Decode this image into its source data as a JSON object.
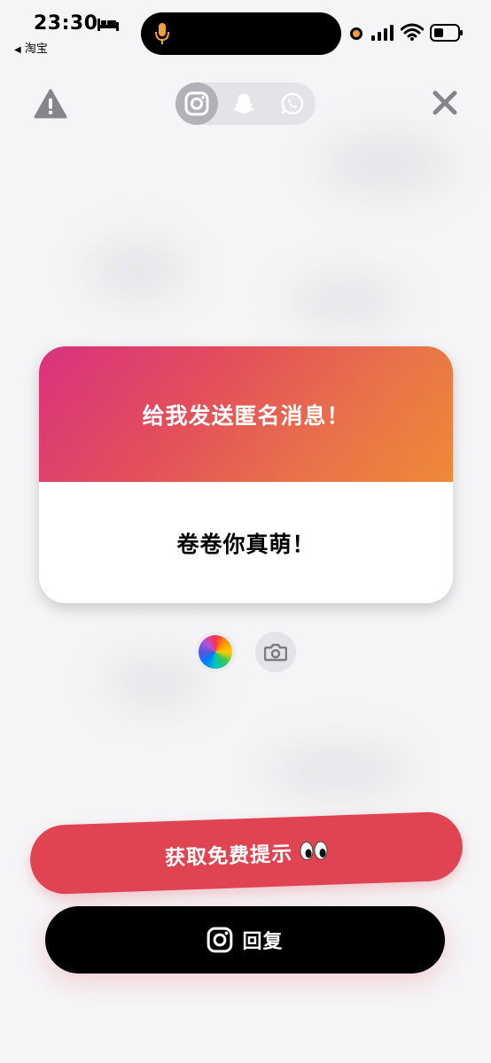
{
  "status_bar": {
    "time": "23:30",
    "back_app": "淘宝",
    "icons": [
      "bed-icon",
      "microphone-icon",
      "recording-dot",
      "cellular-signal-icon",
      "wifi-icon",
      "battery-icon"
    ]
  },
  "toolbar": {
    "warning_icon": "warning-triangle-icon",
    "close_icon": "close-icon",
    "platforms": [
      {
        "name": "instagram",
        "icon": "instagram-icon",
        "active": true
      },
      {
        "name": "snapchat",
        "icon": "snapchat-ghost-icon",
        "active": false
      },
      {
        "name": "whatsapp",
        "icon": "whatsapp-icon",
        "active": false
      }
    ]
  },
  "card": {
    "prompt": "给我发送匿名消息！",
    "message": "卷卷你真萌！",
    "gradient_colors": [
      "#d8327e",
      "#e4505a",
      "#ef8a36"
    ]
  },
  "controls": {
    "color_picker_icon": "color-wheel-icon",
    "camera_icon": "camera-icon"
  },
  "actions": {
    "hint_label": "获取免费提示",
    "hint_icon": "eyes-emoji",
    "reply_label": "回复",
    "reply_icon": "instagram-icon"
  },
  "colors": {
    "hint_button": "#e04452",
    "reply_button": "#000000",
    "background": "#f5f5f7"
  }
}
